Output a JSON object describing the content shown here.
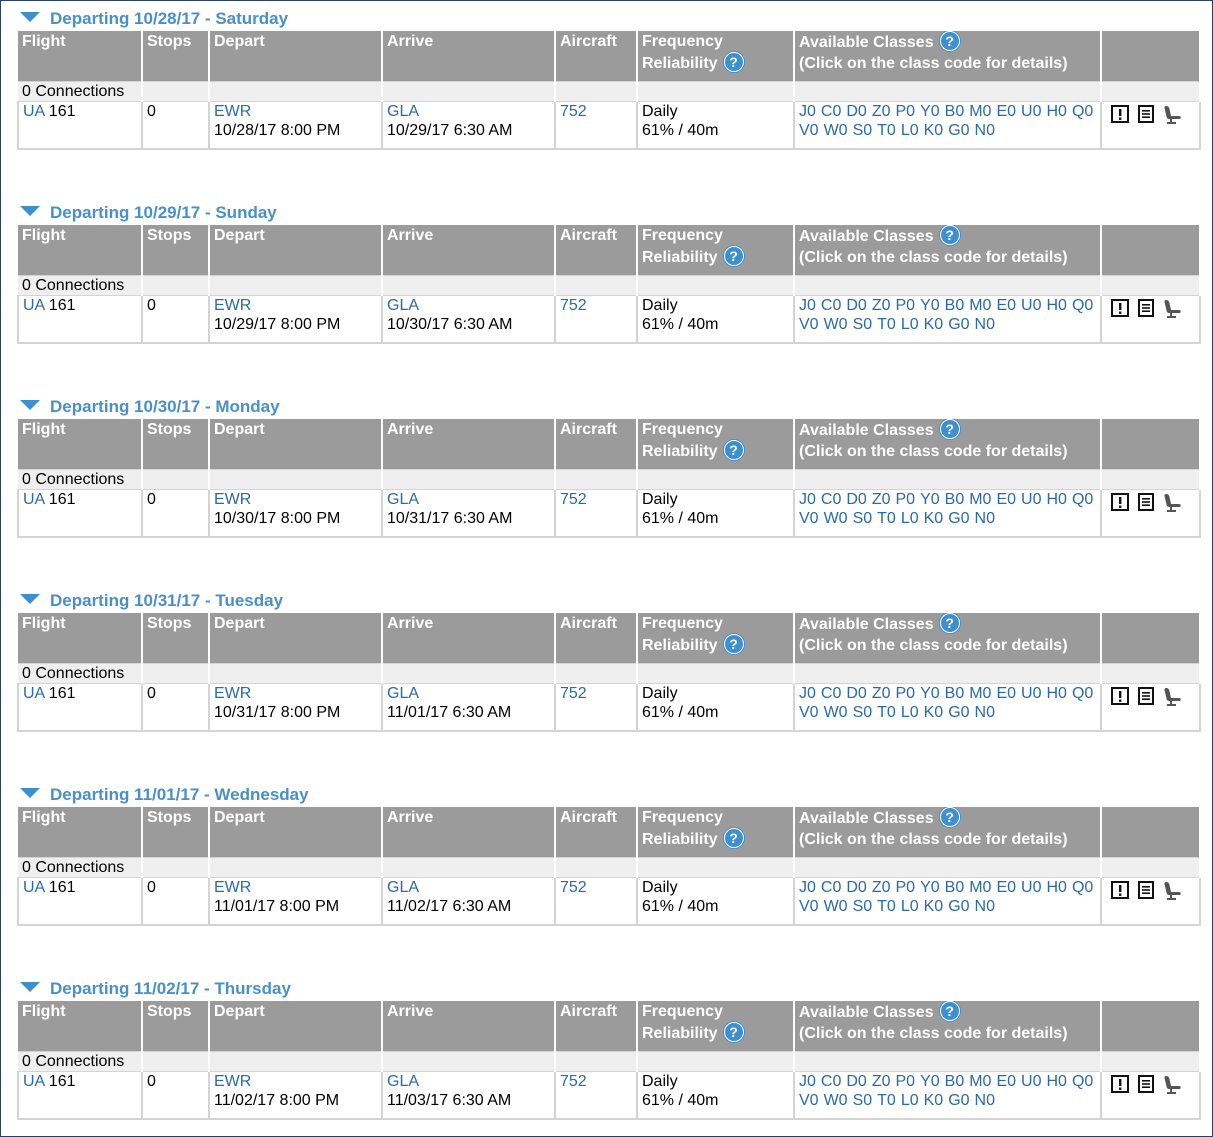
{
  "columns": {
    "flight": "Flight",
    "stops": "Stops",
    "depart": "Depart",
    "arrive": "Arrive",
    "aircraft": "Aircraft",
    "frequency": "Frequency",
    "reliability": "Reliability",
    "available_classes": "Available Classes",
    "classes_hint": "(Click on the class code for details)",
    "help_glyph": "?"
  },
  "days": [
    {
      "header": "Departing 10/28/17 - Saturday",
      "connections": "0 Connections",
      "flight": {
        "airline": "UA",
        "number": "161",
        "stops": "0",
        "depart_airport": "EWR",
        "depart_time": "10/28/17 8:00 PM",
        "arrive_airport": "GLA",
        "arrive_time": "10/29/17 6:30 AM",
        "aircraft": "752",
        "frequency": "Daily",
        "reliability": "61% / 40m"
      }
    },
    {
      "header": "Departing 10/29/17 - Sunday",
      "connections": "0 Connections",
      "flight": {
        "airline": "UA",
        "number": "161",
        "stops": "0",
        "depart_airport": "EWR",
        "depart_time": "10/29/17 8:00 PM",
        "arrive_airport": "GLA",
        "arrive_time": "10/30/17 6:30 AM",
        "aircraft": "752",
        "frequency": "Daily",
        "reliability": "61% / 40m"
      }
    },
    {
      "header": "Departing 10/30/17 - Monday",
      "connections": "0 Connections",
      "flight": {
        "airline": "UA",
        "number": "161",
        "stops": "0",
        "depart_airport": "EWR",
        "depart_time": "10/30/17 8:00 PM",
        "arrive_airport": "GLA",
        "arrive_time": "10/31/17 6:30 AM",
        "aircraft": "752",
        "frequency": "Daily",
        "reliability": "61% / 40m"
      }
    },
    {
      "header": "Departing 10/31/17 - Tuesday",
      "connections": "0 Connections",
      "flight": {
        "airline": "UA",
        "number": "161",
        "stops": "0",
        "depart_airport": "EWR",
        "depart_time": "10/31/17 8:00 PM",
        "arrive_airport": "GLA",
        "arrive_time": "11/01/17 6:30 AM",
        "aircraft": "752",
        "frequency": "Daily",
        "reliability": "61% / 40m"
      }
    },
    {
      "header": "Departing 11/01/17 - Wednesday",
      "connections": "0 Connections",
      "flight": {
        "airline": "UA",
        "number": "161",
        "stops": "0",
        "depart_airport": "EWR",
        "depart_time": "11/01/17 8:00 PM",
        "arrive_airport": "GLA",
        "arrive_time": "11/02/17 6:30 AM",
        "aircraft": "752",
        "frequency": "Daily",
        "reliability": "61% / 40m"
      }
    },
    {
      "header": "Departing 11/02/17 - Thursday",
      "connections": "0 Connections",
      "flight": {
        "airline": "UA",
        "number": "161",
        "stops": "0",
        "depart_airport": "EWR",
        "depart_time": "11/02/17 8:00 PM",
        "arrive_airport": "GLA",
        "arrive_time": "11/03/17 6:30 AM",
        "aircraft": "752",
        "frequency": "Daily",
        "reliability": "61% / 40m"
      }
    }
  ],
  "class_codes_line1": [
    "J0",
    "C0",
    "D0",
    "Z0",
    "P0",
    "Y0",
    "B0",
    "M0",
    "E0",
    "U0",
    "H0",
    "Q0"
  ],
  "class_codes_line2": [
    "V0",
    "W0",
    "S0",
    "T0",
    "L0",
    "K0",
    "G0",
    "N0"
  ],
  "row_icons": [
    "exclamation-icon",
    "list-document-icon",
    "seat-icon"
  ],
  "colors": {
    "link": "#2a6aa8",
    "header_blue": "#4a90c8",
    "column_header_bg": "#9b9b9b"
  }
}
